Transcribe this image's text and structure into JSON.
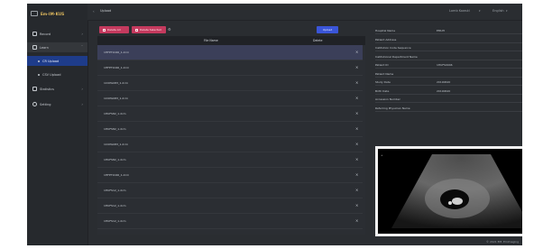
{
  "app": {
    "brand": "Em·IM·KUS"
  },
  "sidebar": {
    "items": [
      {
        "label": "Record",
        "icon": "grid-icon"
      },
      {
        "label": "Learn",
        "icon": "book-icon",
        "expanded": true
      },
      {
        "label": "CR Upload",
        "icon": "dot-icon"
      },
      {
        "label": "CSV Upload",
        "icon": "dot-icon"
      },
      {
        "label": "Statistics",
        "icon": "chart-icon"
      },
      {
        "label": "Setting",
        "icon": "gear-icon"
      }
    ]
  },
  "header": {
    "back": "‹",
    "title": "Upload",
    "user": "Lomb Kowski",
    "lang": "English"
  },
  "toolbar": {
    "delete_all": "Delete All",
    "delete_selected": "Delete Selected",
    "upload": "Upload"
  },
  "table": {
    "columns": [
      "File Name",
      "Delete"
    ],
    "rows": [
      {
        "file": "1HFPT1046_1.dcm",
        "selected": true
      },
      {
        "file": "1HFPT1046_1.dcm"
      },
      {
        "file": "1CUPG083_1.dcm"
      },
      {
        "file": "1CUPG083_1.dcm"
      },
      {
        "file": "1HUFS82_1.dcm"
      },
      {
        "file": "1HUFS82_1.dcm"
      },
      {
        "file": "1CUPG083_1.dcm"
      },
      {
        "file": "1HUFS82_1.dcm"
      },
      {
        "file": "1HFPT1046_1.dcm"
      },
      {
        "file": "1HUFS12_1.dcm"
      },
      {
        "file": "1HUFS12_1.dcm"
      },
      {
        "file": "1HUFS12_1.dcm"
      }
    ],
    "delete_icon": "×"
  },
  "details": {
    "fields": [
      {
        "label": "Hospital Name",
        "value": "EMUH"
      },
      {
        "label": "Patient Address",
        "value": ""
      },
      {
        "label": "Institution Code Sequence",
        "value": ""
      },
      {
        "label": "Institutional Department Name",
        "value": ""
      },
      {
        "label": "Patient ID",
        "value": "1HUFS0046"
      },
      {
        "label": "Patient Name",
        "value": ""
      },
      {
        "label": "Study Date",
        "value": "20190620"
      },
      {
        "label": "Birth Date",
        "value": "20190620"
      },
      {
        "label": "Accession Number",
        "value": ""
      },
      {
        "label": "Referring Physician Name",
        "value": ""
      }
    ]
  },
  "footer": "© 2021 EM. EmImaging"
}
